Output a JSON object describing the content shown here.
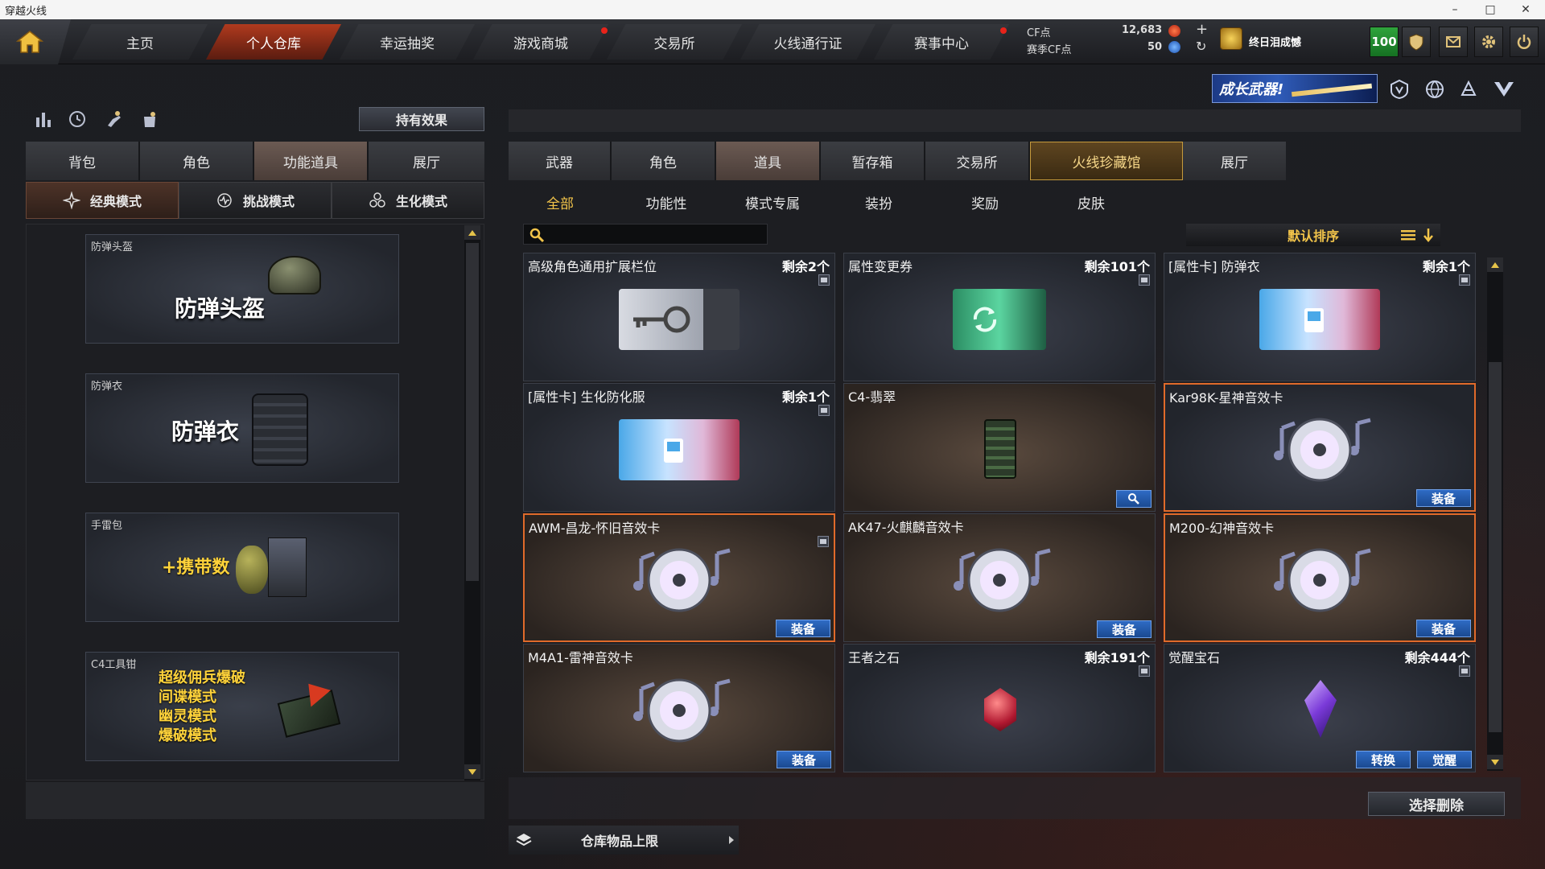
{
  "window": {
    "title": "穿越火线",
    "controls": [
      "–",
      "□",
      "✕"
    ]
  },
  "nav": {
    "tabs": [
      {
        "label": "主页"
      },
      {
        "label": "个人仓库"
      },
      {
        "label": "幸运抽奖"
      },
      {
        "label": "游戏商城"
      },
      {
        "label": "交易所"
      },
      {
        "label": "火线通行证"
      },
      {
        "label": "赛事中心"
      }
    ],
    "cf_label": "CF点",
    "cf_value": "12,683",
    "season_label": "赛季CF点",
    "season_value": "50",
    "plus": "+",
    "refresh": "↻",
    "rank_title": "终日泪成憾",
    "level": "100"
  },
  "banner": {
    "text": "成长武器!"
  },
  "left": {
    "effect_button": "持有效果",
    "tabs": [
      {
        "label": "背包"
      },
      {
        "label": "角色"
      },
      {
        "label": "功能道具"
      },
      {
        "label": "展厅"
      }
    ],
    "modes": [
      {
        "label": "经典模式"
      },
      {
        "label": "挑战模式"
      },
      {
        "label": "生化模式"
      }
    ],
    "items": [
      {
        "label": "防弹头盔",
        "big": "防弹头盔"
      },
      {
        "label": "防弹衣",
        "big": "防弹衣"
      },
      {
        "label": "手雷包",
        "big": "+携带数"
      },
      {
        "label": "C4工具钳",
        "lines": [
          "超级佣兵爆破",
          "间谍模式",
          "幽灵模式",
          "爆破模式"
        ]
      }
    ]
  },
  "right": {
    "tabs": [
      {
        "label": "武器"
      },
      {
        "label": "角色"
      },
      {
        "label": "道具"
      },
      {
        "label": "暂存箱"
      },
      {
        "label": "交易所"
      },
      {
        "label": "火线珍藏馆"
      },
      {
        "label": "展厅"
      }
    ],
    "subtabs": [
      {
        "label": "全部"
      },
      {
        "label": "功能性"
      },
      {
        "label": "模式专属"
      },
      {
        "label": "装扮"
      },
      {
        "label": "奖励"
      },
      {
        "label": "皮肤"
      }
    ],
    "sort_label": "默认排序",
    "items": [
      {
        "name": "高级角色通用扩展栏位",
        "count": "剩余2个",
        "type": "key"
      },
      {
        "name": "属性变更券",
        "count": "剩余101个",
        "type": "ticket"
      },
      {
        "name": "[属性卡] 防弹衣",
        "count": "剩余1个",
        "type": "vest"
      },
      {
        "name": "[属性卡] 生化防化服",
        "count": "剩余1个",
        "type": "vest"
      },
      {
        "name": "C4-翡翠",
        "count": "",
        "type": "c4"
      },
      {
        "name": "Kar98K-星神音效卡",
        "count": "",
        "type": "disc",
        "button": "装备"
      },
      {
        "name": "AWM-昌龙-怀旧音效卡",
        "count": "",
        "type": "disc",
        "button": "装备"
      },
      {
        "name": "AK47-火麒麟音效卡",
        "count": "",
        "type": "disc",
        "button": "装备"
      },
      {
        "name": "M200-幻神音效卡",
        "count": "",
        "type": "disc",
        "button": "装备"
      },
      {
        "name": "M4A1-雷神音效卡",
        "count": "",
        "type": "disc",
        "button": "装备"
      },
      {
        "name": "王者之石",
        "count": "剩余191个",
        "type": "ruby"
      },
      {
        "name": "觉醒宝石",
        "count": "剩余444个",
        "type": "gem",
        "buttons": [
          "转换",
          "觉醒"
        ]
      }
    ],
    "delete_button": "选择删除",
    "storage_label": "仓库物品上限"
  },
  "colors": {
    "accent_red": "#b03a1e",
    "gold": "#f2c44a",
    "blue_btn": "#2f6bc4",
    "level_green": "#2fa43c"
  }
}
